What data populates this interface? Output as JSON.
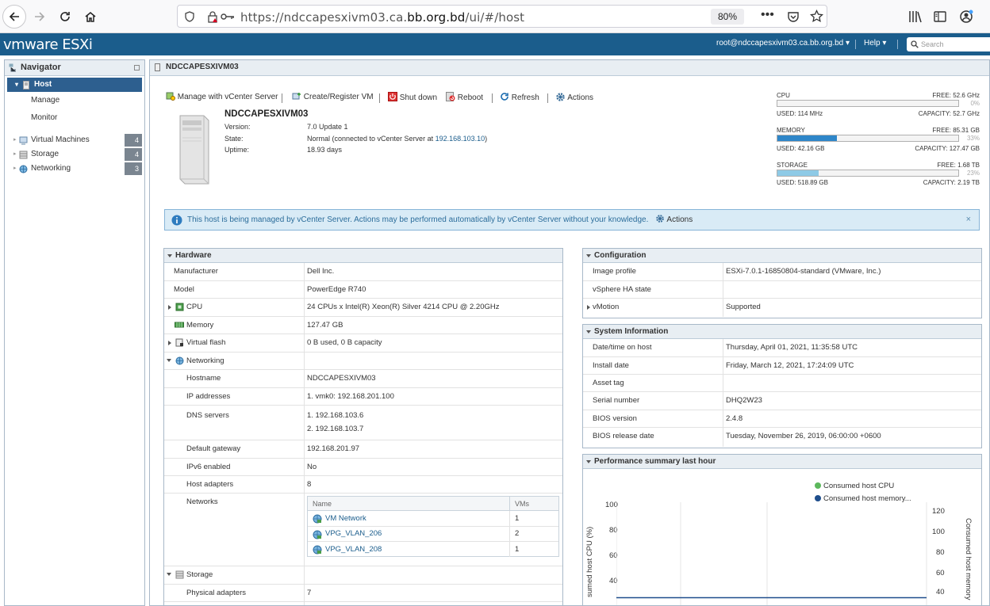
{
  "browser": {
    "url_prefix": "https://ndccapesxivm03.ca.",
    "url_domain": "bb.org.bd",
    "url_suffix": "/ui/#/host",
    "zoom": "80%"
  },
  "header": {
    "logo": "vmware ESXi",
    "user": "root@ndccapesxivm03.ca.bb.org.bd",
    "help": "Help",
    "search_placeholder": "Search"
  },
  "navigator": {
    "title": "Navigator",
    "host": "Host",
    "manage": "Manage",
    "monitor": "Monitor",
    "items": [
      {
        "label": "Virtual Machines",
        "count": "4"
      },
      {
        "label": "Storage",
        "count": "4"
      },
      {
        "label": "Networking",
        "count": "3"
      }
    ]
  },
  "main": {
    "title": "NDCCAPESXIVM03",
    "toolbar": {
      "manage_vcenter": "Manage with vCenter Server",
      "create_vm": "Create/Register VM",
      "shutdown": "Shut down",
      "reboot": "Reboot",
      "refresh": "Refresh",
      "actions": "Actions"
    },
    "host": {
      "name": "NDCCAPESXIVM03",
      "version_label": "Version:",
      "version": "7.0 Update 1",
      "state_label": "State:",
      "state": "Normal (connected to vCenter Server at ",
      "state_ip": "192.168.103.10",
      "state_end": ")",
      "uptime_label": "Uptime:",
      "uptime": "18.93 days"
    },
    "resources": {
      "cpu": {
        "label": "CPU",
        "free": "FREE: 52.6 GHz",
        "pct": "0%",
        "used": "USED: 114 MHz",
        "capacity": "CAPACITY: 52.7 GHz",
        "fraction": 0.0
      },
      "memory": {
        "label": "MEMORY",
        "free": "FREE: 85.31 GB",
        "pct": "33%",
        "used": "USED: 42.16 GB",
        "capacity": "CAPACITY: 127.47 GB",
        "fraction": 0.33
      },
      "storage": {
        "label": "STORAGE",
        "free": "FREE: 1.68 TB",
        "pct": "23%",
        "used": "USED: 518.89 GB",
        "capacity": "CAPACITY: 2.19 TB",
        "fraction": 0.23
      }
    },
    "alert": {
      "text": "This host is being managed by vCenter Server. Actions may be performed automatically by vCenter Server without your knowledge.",
      "actions": "Actions"
    }
  },
  "hardware": {
    "title": "Hardware",
    "rows": [
      {
        "label": "Manufacturer",
        "value": "Dell Inc."
      },
      {
        "label": "Model",
        "value": "PowerEdge R740"
      },
      {
        "label": "CPU",
        "value": "24 CPUs x Intel(R) Xeon(R) Silver 4214 CPU @ 2.20GHz"
      },
      {
        "label": "Memory",
        "value": "127.47 GB"
      },
      {
        "label": "Virtual flash",
        "value": "0 B used, 0 B capacity"
      },
      {
        "label": "Networking",
        "value": ""
      },
      {
        "label": "Hostname",
        "value": "NDCCAPESXIVM03"
      },
      {
        "label": "IP addresses",
        "value": "1. vmk0: 192.168.201.100"
      },
      {
        "label": "DNS servers",
        "value": "1. 192.168.103.6",
        "value2": "2. 192.168.103.7"
      },
      {
        "label": "Default gateway",
        "value": "192.168.201.97"
      },
      {
        "label": "IPv6 enabled",
        "value": "No"
      },
      {
        "label": "Host adapters",
        "value": "8"
      },
      {
        "label": "Networks",
        "value": ""
      },
      {
        "label": "Storage",
        "value": ""
      },
      {
        "label": "Physical adapters",
        "value": "7"
      }
    ],
    "networks_table": {
      "col_name": "Name",
      "col_vms": "VMs",
      "rows": [
        {
          "name": "VM Network",
          "vms": "1"
        },
        {
          "name": "VPG_VLAN_206",
          "vms": "2"
        },
        {
          "name": "VPG_VLAN_208",
          "vms": "1"
        }
      ]
    }
  },
  "configuration": {
    "title": "Configuration",
    "rows": [
      {
        "label": "Image profile",
        "value": "ESXi-7.0.1-16850804-standard (VMware, Inc.)"
      },
      {
        "label": "vSphere HA state",
        "value": ""
      },
      {
        "label": "vMotion",
        "value": "Supported"
      }
    ]
  },
  "system_info": {
    "title": "System Information",
    "rows": [
      {
        "label": "Date/time on host",
        "value": "Thursday, April 01, 2021, 11:35:58 UTC"
      },
      {
        "label": "Install date",
        "value": "Friday, March 12, 2021, 17:24:09 UTC"
      },
      {
        "label": "Asset tag",
        "value": ""
      },
      {
        "label": "Serial number",
        "value": "DHQ2W23"
      },
      {
        "label": "BIOS version",
        "value": "2.4.8"
      },
      {
        "label": "BIOS release date",
        "value": "Tuesday, November 26, 2019, 06:00:00 +0600"
      }
    ]
  },
  "performance": {
    "title": "Performance summary last hour",
    "legend_cpu": "Consumed host CPU",
    "legend_mem": "Consumed host memory...",
    "left_axis_label": "sumed host CPU (%)",
    "right_axis_label": "Consumed host memory",
    "left_ticks": [
      "100",
      "80",
      "60",
      "40"
    ],
    "right_ticks": [
      "120",
      "100",
      "80",
      "60",
      "40"
    ],
    "colors": {
      "cpu": "#5cb85c",
      "memory": "#1f4e8c"
    }
  }
}
